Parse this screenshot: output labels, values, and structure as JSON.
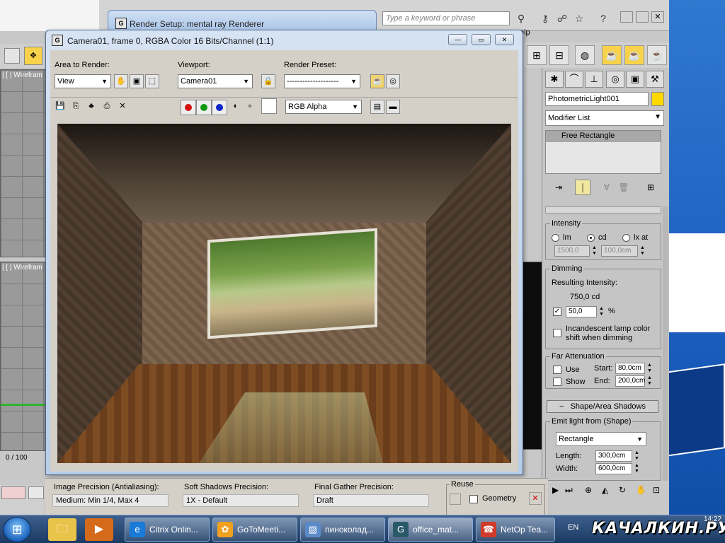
{
  "max": {
    "search_placeholder": "Type a keyword or phrase",
    "help_menu_fragment": "elp",
    "viewport_top_label": "| [ | Wirefram",
    "viewport_bottom_label": "| [ | Wirefram",
    "time_slider": "0 / 100"
  },
  "render_setup": {
    "title": "Render Setup: mental ray Renderer",
    "image_precision_label": "Image Precision (Antialiasing):",
    "image_precision_value": "Medium: Min 1/4, Max 4",
    "soft_shadows_label": "Soft Shadows Precision:",
    "soft_shadows_value": "1X - Default",
    "final_gather_label": "Final Gather Precision:",
    "final_gather_value": "Draft",
    "reuse_label": "Reuse",
    "geometry_label": "Geometry",
    "final_gather_cut": "Final Ga..."
  },
  "frame_window": {
    "title": "Camera01, frame 0, RGBA Color 16 Bits/Channel (1:1)",
    "area_label": "Area to Render:",
    "area_value": "View",
    "viewport_label": "Viewport:",
    "viewport_value": "Camera01",
    "preset_label": "Render Preset:",
    "preset_value": "--------------------",
    "channel_value": "RGB Alpha"
  },
  "command_panel": {
    "object_name": "PhotometricLight001",
    "object_color": "#ffd800",
    "modifier_list": "Modifier List",
    "stack_item": "Free Rectangle",
    "intensity": {
      "title": "Intensity",
      "opt_lm": "lm",
      "opt_cd": "cd",
      "opt_lxat": "lx at",
      "val1": "1500,0",
      "val2": "100,0cm"
    },
    "dimming": {
      "title": "Dimming",
      "resulting_label": "Resulting Intensity:",
      "resulting_value": "750,0 cd",
      "percent_value": "50,0",
      "percent_sign": "%",
      "incandescent_label": "Incandescent lamp color shift when dimming"
    },
    "far_attenuation": {
      "title": "Far Attenuation",
      "use_label": "Use",
      "show_label": "Show",
      "start_label": "Start:",
      "start_value": "80,0cm",
      "end_label": "End:",
      "end_value": "200,0cm"
    },
    "shape_shadows": {
      "title": "Shape/Area Shadows",
      "emit_label": "Emit light from (Shape)",
      "shape_value": "Rectangle",
      "length_label": "Length:",
      "length_value": "300,0cm",
      "width_label": "Width:",
      "width_value": "600,0cm"
    }
  },
  "taskbar": {
    "tasks": [
      {
        "label": "Citrix Onlin..."
      },
      {
        "label": "GoToMeeti..."
      },
      {
        "label": "пиноколад..."
      },
      {
        "label": "office_mat..."
      },
      {
        "label": "NetOp Tea..."
      }
    ],
    "language": "EN",
    "clock_fragment": "14:22",
    "watermark": "КАЧАЛКИН.РУ"
  }
}
